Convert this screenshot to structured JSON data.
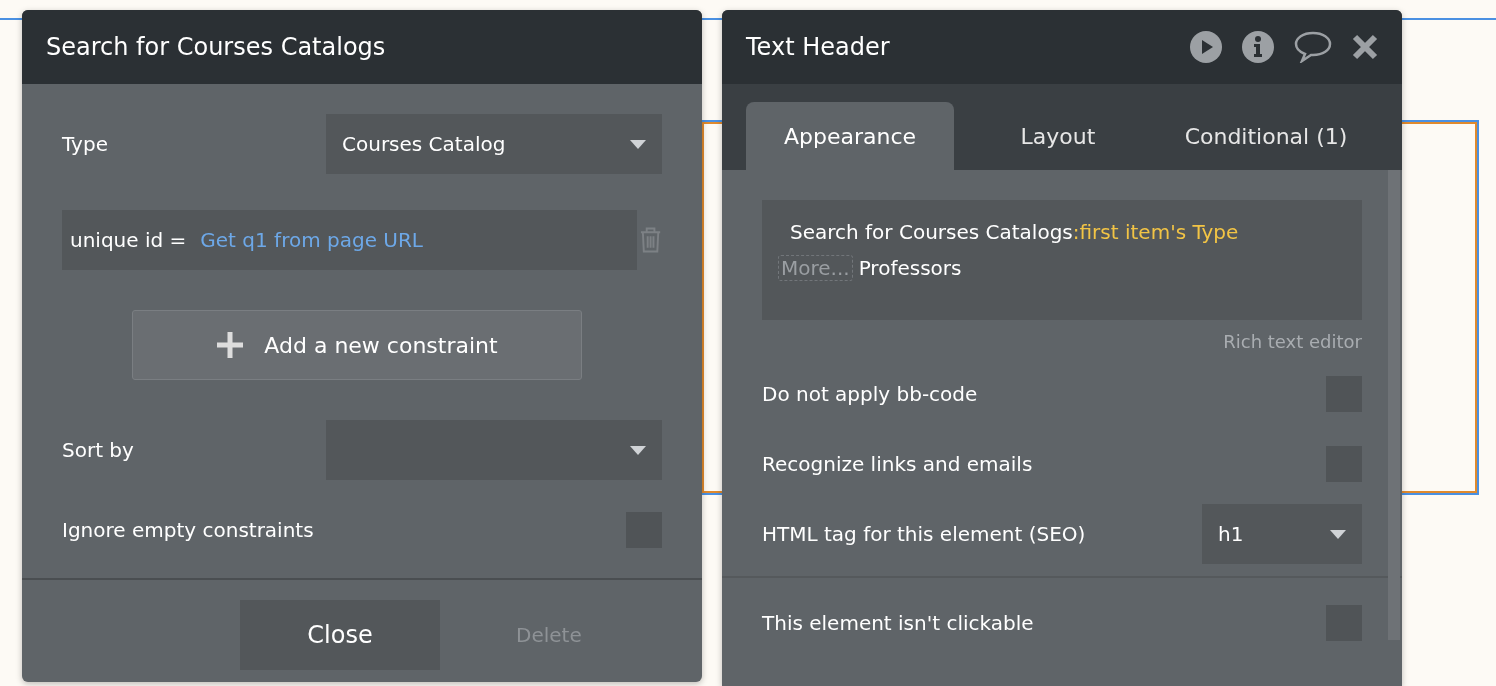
{
  "canvas": {
    "element_selected": true
  },
  "search_panel": {
    "title": "Search for Courses Catalogs",
    "type": {
      "label": "Type",
      "value": "Courses Catalog"
    },
    "constraints": [
      {
        "field": "unique id =",
        "value": "Get q1 from page URL"
      }
    ],
    "add_button": "Add a new constraint",
    "sort_by": {
      "label": "Sort by"
    },
    "ignore_empty": {
      "label": "Ignore empty constraints",
      "checked": false
    },
    "close_button": "Close",
    "delete_button": {
      "label": "Delete",
      "disabled": true
    }
  },
  "property_editor": {
    "title": "Text Header",
    "tabs": [
      {
        "label": "Appearance",
        "selected": true
      },
      {
        "label": "Layout",
        "selected": false
      },
      {
        "label": "Conditional (1)",
        "selected": false
      }
    ],
    "content": {
      "source": "Search for Courses Catalogs",
      "expression": ":first item's Type",
      "more": "More...",
      "text": "Professors"
    },
    "rich_text_link": "Rich text editor",
    "options": [
      {
        "kind": "checkbox",
        "label": "Do not apply bb-code",
        "checked": false
      },
      {
        "kind": "checkbox",
        "label": "Recognize links and emails",
        "checked": false
      },
      {
        "kind": "select",
        "label": "HTML tag for this element (SEO)",
        "value": "h1"
      },
      {
        "kind": "divider"
      },
      {
        "kind": "checkbox",
        "label": "This element isn't clickable",
        "checked": false
      }
    ]
  }
}
